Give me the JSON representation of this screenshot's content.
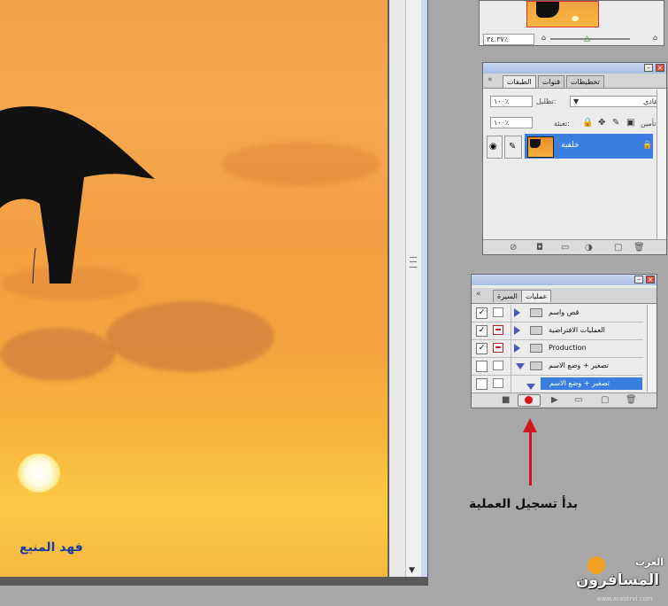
{
  "canvas": {
    "caption": "فهد المنيع"
  },
  "navigator": {
    "zoom": "٣٤.٣٧٪"
  },
  "layers_panel": {
    "tabs": [
      "تخطيطات",
      "قنوات",
      "الطبقات"
    ],
    "blend_mode": "عادي",
    "opacity_label": "تظليل:",
    "opacity_value": "١٠٠٪",
    "lock_label": "تأمين:",
    "fill_label": "تعبئة:",
    "fill_value": "١٠٠٪",
    "layer_name": "خلفية"
  },
  "actions_panel": {
    "tabs": [
      "عمليات",
      "السيرة"
    ],
    "rows": [
      {
        "name": "قص واسم",
        "checked": true,
        "dialog": false
      },
      {
        "name": "العمليات الافتراضية",
        "checked": true,
        "dialog": true
      },
      {
        "name": "Production",
        "checked": true,
        "dialog": true
      },
      {
        "name": "تصغير + وضع الاسم",
        "checked": false,
        "dialog": false
      }
    ],
    "selected_action": "تصغير + وضع الاسم"
  },
  "annotation": {
    "text": "بدأ تسجيل العملية"
  },
  "logo": {
    "word": "العرب",
    "site": "المسافرون",
    "url": "www.arabtrvl.com"
  }
}
